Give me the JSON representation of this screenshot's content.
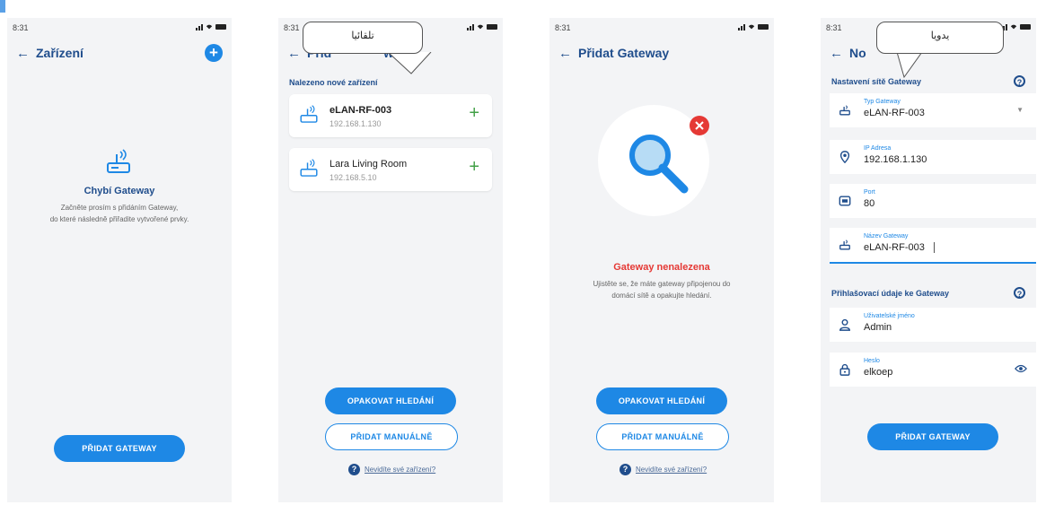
{
  "status_time": "8:31",
  "screen1": {
    "title": "Zařízení",
    "empty_title": "Chybí Gateway",
    "empty_desc_1": "Začněte prosím s přidáním Gateway,",
    "empty_desc_2": "do které následně přiřadite vytvořené prvky.",
    "add_button": "PŘIDAT GATEWAY"
  },
  "screen2": {
    "callout": "تلقائيا",
    "title_fragment_left": "Přid",
    "title_fragment_right": "way",
    "section": "Nalezeno nové zařízení",
    "devices": [
      {
        "name": "eLAN-RF-003",
        "ip": "192.168.1.130"
      },
      {
        "name": "Lara Living Room",
        "ip": "192.168.5.10"
      }
    ],
    "retry_button": "OPAKOVAT HLEDÁNÍ",
    "manual_button": "PŘIDAT MANUÁLNĚ",
    "help_link": "Nevidíte své zařízení?"
  },
  "screen3": {
    "title": "Přidat Gateway",
    "error_title": "Gateway nenalezena",
    "error_desc_1": "Ujistěte se, že máte gateway připojenou do",
    "error_desc_2": "domácí sítě a opakujte hledání.",
    "retry_button": "OPAKOVAT HLEDÁNÍ",
    "manual_button": "PŘIDAT MANUÁLNĚ",
    "help_link": "Nevidíte své zařízení?"
  },
  "screen4": {
    "callout": "يدويا",
    "title_fragment": "No",
    "section_network": "Nastavení sítě Gateway",
    "fields_network": [
      {
        "label": "Typ Gateway",
        "value": "eLAN-RF-003"
      },
      {
        "label": "IP Adresa",
        "value": "192.168.1.130"
      },
      {
        "label": "Port",
        "value": "80"
      },
      {
        "label": "Název Gateway",
        "value": "eLAN-RF-003"
      }
    ],
    "section_login": "Přihlašovací údaje ke Gateway",
    "fields_login": [
      {
        "label": "Uživatelské jméno",
        "value": "Admin"
      },
      {
        "label": "Heslo",
        "value": "elkoep"
      }
    ],
    "add_button": "PŘIDAT GATEWAY"
  },
  "colors": {
    "primary": "#1e88e5",
    "title": "#1f4d8c",
    "error": "#e53935",
    "success": "#43a047"
  }
}
